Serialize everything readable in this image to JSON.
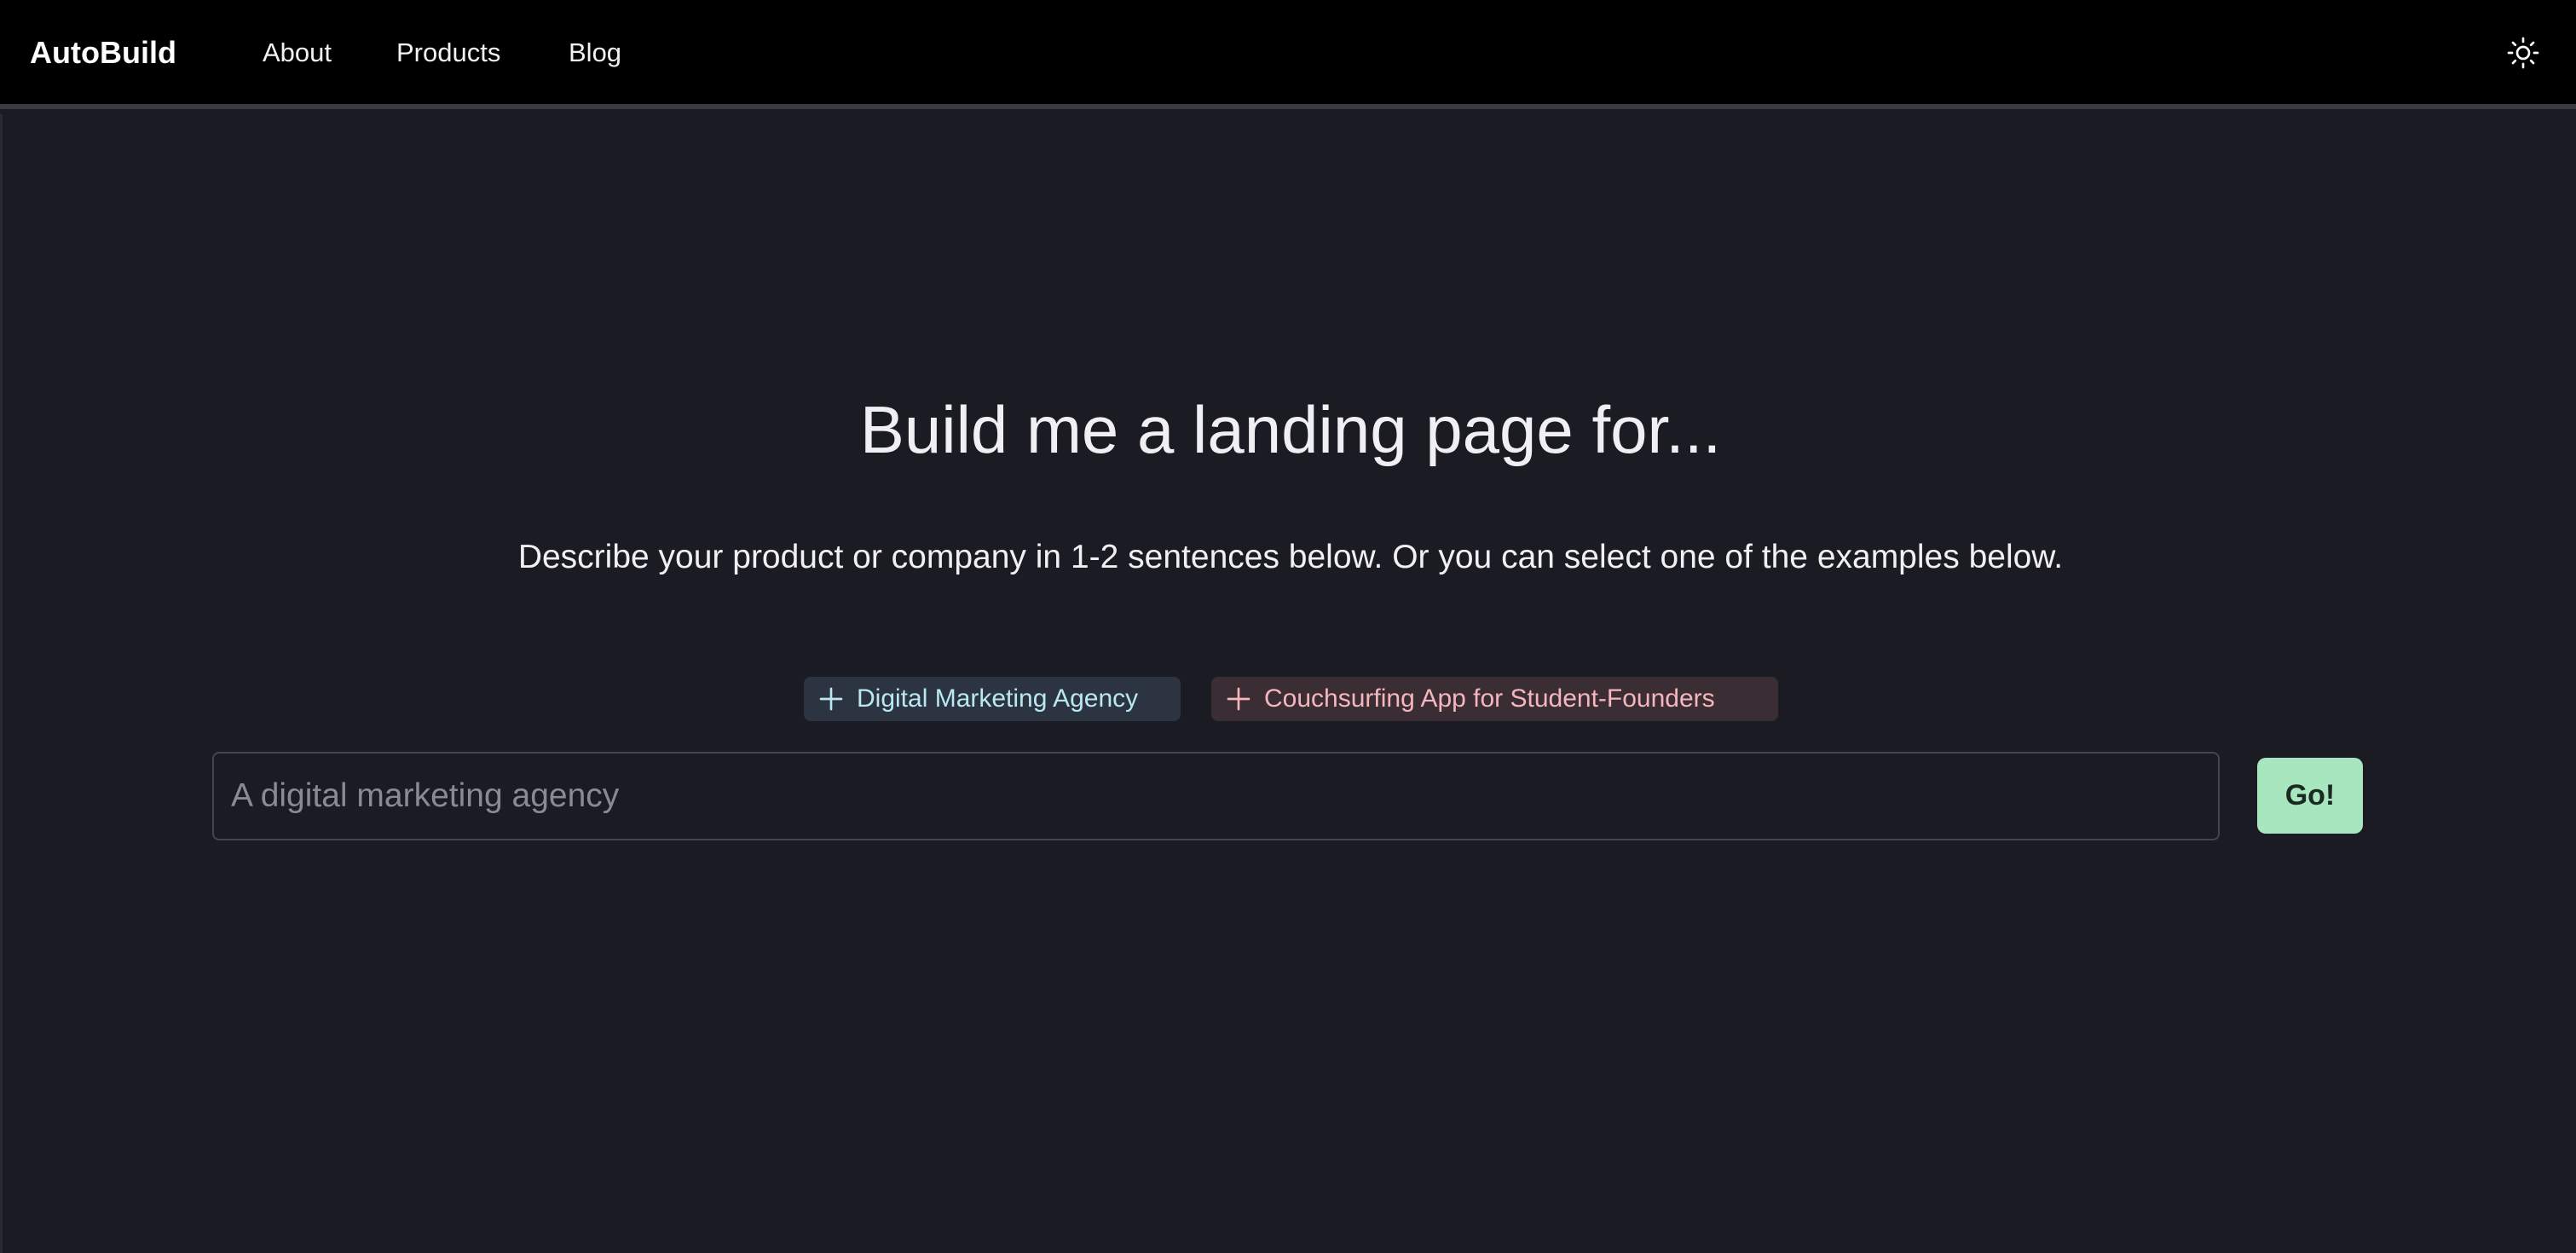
{
  "navbar": {
    "brand": "AutoBuild",
    "links": [
      {
        "label": "About"
      },
      {
        "label": "Products"
      },
      {
        "label": "Blog"
      }
    ],
    "theme_toggle_icon": "sun-icon"
  },
  "hero": {
    "headline": "Build me a landing page for...",
    "subtext": "Describe your product or company in 1-2 sentences below. Or you can select one of the examples below."
  },
  "examples": [
    {
      "label": "Digital Marketing Agency",
      "icon": "plus-icon",
      "color": "#b9e7f2",
      "background": "#2b3440"
    },
    {
      "label": "Couchsurfing App for Student-Founders",
      "icon": "plus-icon",
      "color": "#f5b6bd",
      "background": "#3a2d33"
    }
  ],
  "prompt_input": {
    "value": "",
    "placeholder": "A digital marketing agency"
  },
  "submit": {
    "label": "Go!",
    "color": "#a8e6bf"
  },
  "colors": {
    "navbar_bg": "#000000",
    "page_bg": "#1b1b23"
  }
}
